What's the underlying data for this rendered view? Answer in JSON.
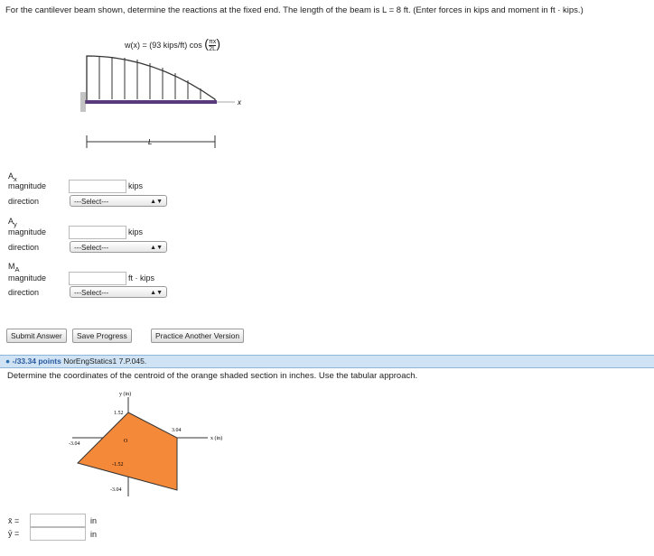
{
  "q1": {
    "prompt": "For the cantilever beam shown, determine the reactions at the fixed end. The length of the beam is L = 8 ft. (Enter forces in kips and moment in ft · kips.)",
    "load_label": "w(x) = (93 kips/ft) cos",
    "load_frac_num": "πx",
    "load_frac_den": "2L",
    "beam_length_label": "L",
    "x_axis_label": "x",
    "fields": [
      {
        "symbol": "A",
        "sub": "x",
        "magnitude_label": "magnitude",
        "unit": "kips",
        "direction_label": "direction",
        "select_value": "---Select---"
      },
      {
        "symbol": "A",
        "sub": "y",
        "magnitude_label": "magnitude",
        "unit": "kips",
        "direction_label": "direction",
        "select_value": "---Select---"
      },
      {
        "symbol": "M",
        "sub": "A",
        "magnitude_label": "magnitude",
        "unit": "ft · kips",
        "direction_label": "direction",
        "select_value": "---Select---"
      }
    ],
    "buttons": {
      "submit": "Submit Answer",
      "save": "Save Progress",
      "practice": "Practice Another Version"
    }
  },
  "q2": {
    "points": "-/33.34 points",
    "code": "NorEngStatics1 7.P.045.",
    "prompt": "Determine the coordinates of the centroid of the orange shaded section in inches. Use the tabular approach.",
    "y_axis_label": "y (in)",
    "x_axis_label": "x (in)",
    "ticks": {
      "y_top": "1.52",
      "x_right": "3.04",
      "x_left": "-3.04",
      "origin": "O",
      "y_m152": "-1.52",
      "y_m304": "-3.04"
    },
    "shape_color": "#f5893a",
    "answers": [
      {
        "label": "x̄ =",
        "unit": "in"
      },
      {
        "label": "ȳ =",
        "unit": "in"
      }
    ]
  }
}
